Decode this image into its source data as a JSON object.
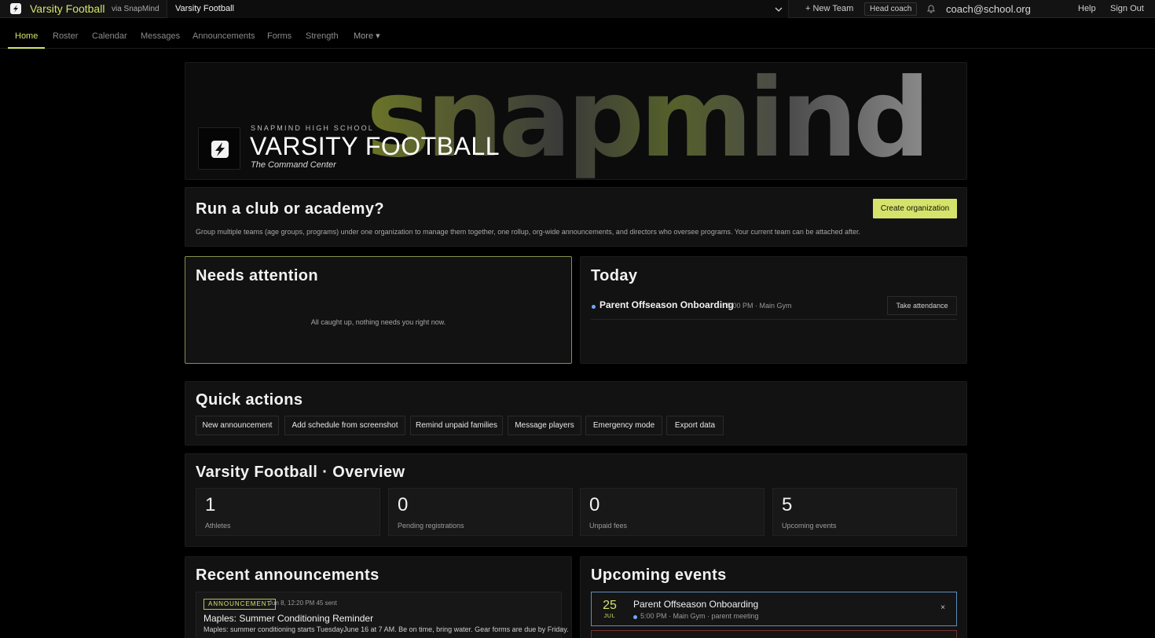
{
  "topbar": {
    "app_title": "Varsity Football",
    "via": "via SnapMind",
    "team_select_value": "Varsity Football",
    "new_team": "+ New Team",
    "role": "Head coach",
    "email": "coach@school.org",
    "help": "Help",
    "sign_out": "Sign Out"
  },
  "nav": {
    "items": [
      "Home",
      "Roster",
      "Calendar",
      "Messages",
      "Announcements",
      "Forms",
      "Strength",
      "More ▾"
    ],
    "active": "Home"
  },
  "hero": {
    "wordmark": "snapmind",
    "school": "SNAPMIND HIGH SCHOOL",
    "title": "VARSITY FOOTBALL",
    "tagline": "The Command Center"
  },
  "club": {
    "title": "Run a club or academy?",
    "description": "Group multiple teams (age groups, programs) under one organization to manage them together, one rollup, org-wide announcements, and directors who oversee programs. Your current team can be attached after.",
    "button": "Create organization"
  },
  "needs_attention": {
    "title": "Needs attention",
    "empty": "All caught up, nothing needs you right now."
  },
  "today": {
    "title": "Today",
    "event_title": "Parent Offseason Onboarding",
    "event_meta": "5:00 PM · Main Gym",
    "button": "Take attendance"
  },
  "quick_actions": {
    "title": "Quick actions",
    "buttons": [
      "New announcement",
      "Add schedule from screenshot",
      "Remind unpaid families",
      "Message players",
      "Emergency mode",
      "Export data"
    ]
  },
  "overview": {
    "title": "Varsity Football · Overview",
    "stats": [
      {
        "value": "1",
        "label": "Athletes"
      },
      {
        "value": "0",
        "label": "Pending registrations"
      },
      {
        "value": "0",
        "label": "Unpaid fees"
      },
      {
        "value": "5",
        "label": "Upcoming events"
      }
    ]
  },
  "announcements": {
    "title": "Recent announcements",
    "items": [
      {
        "tag": "ANNOUNCEMENT",
        "meta": "Jun 8, 12:20 PM   45 sent",
        "title": "Maples: Summer Conditioning Reminder",
        "body": "Maples: summer conditioning starts TuesdayJune 16 at 7 AM. Be on time, bring water. Gear forms are due by Friday."
      }
    ]
  },
  "upcoming": {
    "title": "Upcoming events",
    "events": [
      {
        "day": "25",
        "month": "JUL",
        "name": "Parent Offseason Onboarding",
        "sub": "5:00 PM · Main Gym · parent meeting",
        "close": "×"
      }
    ]
  },
  "colors": {
    "accent": "#d6e36a",
    "event_dot": "#6fa8ff",
    "background": "#000000",
    "panel": "#121212"
  }
}
